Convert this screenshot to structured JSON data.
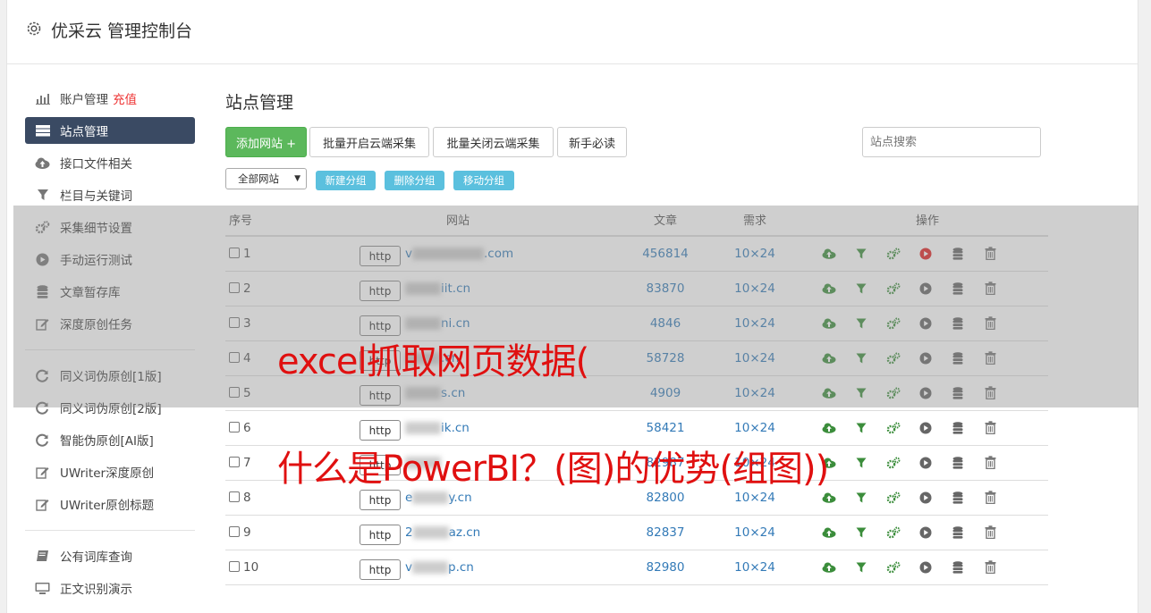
{
  "header": {
    "title": "优采云 管理控制台"
  },
  "sidebar": {
    "groups": [
      [
        {
          "label": "账户管理",
          "badge": "充值",
          "icon": "bar-chart-icon"
        },
        {
          "label": "站点管理",
          "icon": "server-icon",
          "active": true
        },
        {
          "label": "接口文件相关",
          "icon": "cloud-upload-icon"
        },
        {
          "label": "栏目与关键词",
          "icon": "filter-icon"
        },
        {
          "label": "采集细节设置",
          "icon": "gears-icon"
        },
        {
          "label": "手动运行测试",
          "icon": "play-circle-icon"
        },
        {
          "label": "文章暂存库",
          "icon": "database-icon"
        },
        {
          "label": "深度原创任务",
          "icon": "edit-icon"
        }
      ],
      [
        {
          "label": "同义词伪原创[1版]",
          "icon": "refresh-icon"
        },
        {
          "label": "同义词伪原创[2版]",
          "icon": "refresh-icon"
        },
        {
          "label": "智能伪原创[AI版]",
          "icon": "refresh-icon"
        },
        {
          "label": "UWriter深度原创",
          "icon": "edit-icon"
        },
        {
          "label": "UWriter原创标题",
          "icon": "edit-icon"
        }
      ],
      [
        {
          "label": "公有词库查询",
          "icon": "book-icon"
        },
        {
          "label": "正文识别演示",
          "icon": "monitor-icon"
        }
      ]
    ]
  },
  "main": {
    "title": "站点管理",
    "toolbar": {
      "add_site": "添加网站 +",
      "batch_open": "批量开启云端采集",
      "batch_close": "批量关闭云端采集",
      "newbie": "新手必读",
      "search_placeholder": "站点搜索"
    },
    "group_bar": {
      "select_value": "全部网站",
      "new_group": "新建分组",
      "delete_group": "删除分组",
      "move_group": "移动分组"
    },
    "table": {
      "headers": [
        "序号",
        "网站",
        "文章",
        "需求",
        "操作"
      ],
      "rows": [
        {
          "no": "1",
          "protocol": "http",
          "prefix": "v",
          "suffix": ".com",
          "articles": "456814",
          "demand": "10×24",
          "status": "red"
        },
        {
          "no": "2",
          "protocol": "http",
          "prefix": "",
          "suffix": "iit.cn",
          "articles": "83870",
          "demand": "10×24",
          "status": "gray"
        },
        {
          "no": "3",
          "protocol": "http",
          "prefix": "",
          "suffix": "ni.cn",
          "articles": "4846",
          "demand": "10×24",
          "status": "gray"
        },
        {
          "no": "4",
          "protocol": "http",
          "prefix": "",
          "suffix": ".cn",
          "articles": "58728",
          "demand": "10×24",
          "status": "gray"
        },
        {
          "no": "5",
          "protocol": "http",
          "prefix": "",
          "suffix": "s.cn",
          "articles": "4909",
          "demand": "10×24",
          "status": "gray"
        },
        {
          "no": "6",
          "protocol": "http",
          "prefix": "",
          "suffix": "ik.cn",
          "articles": "58421",
          "demand": "10×24",
          "status": "gray"
        },
        {
          "no": "7",
          "protocol": "http",
          "prefix": "",
          "suffix": "",
          "articles": "82987",
          "demand": "10×24",
          "status": "gray"
        },
        {
          "no": "8",
          "protocol": "http",
          "prefix": "e",
          "suffix": "y.cn",
          "articles": "82800",
          "demand": "10×24",
          "status": "gray"
        },
        {
          "no": "9",
          "protocol": "http",
          "prefix": "2",
          "suffix": "az.cn",
          "articles": "82837",
          "demand": "10×24",
          "status": "gray"
        },
        {
          "no": "10",
          "protocol": "http",
          "prefix": "v",
          "suffix": "p.cn",
          "articles": "82980",
          "demand": "10×24",
          "status": "gray"
        }
      ]
    }
  },
  "watermark": {
    "line1": "excel抓取网页数据(",
    "line2": "什么是PowerBI？(图)的优势(组图))"
  },
  "colors": {
    "accent_green": "#5cb85c",
    "accent_blue": "#5bc0de",
    "active_nav": "#3a4a63",
    "link": "#337ab7",
    "watermark": "#e01010"
  }
}
